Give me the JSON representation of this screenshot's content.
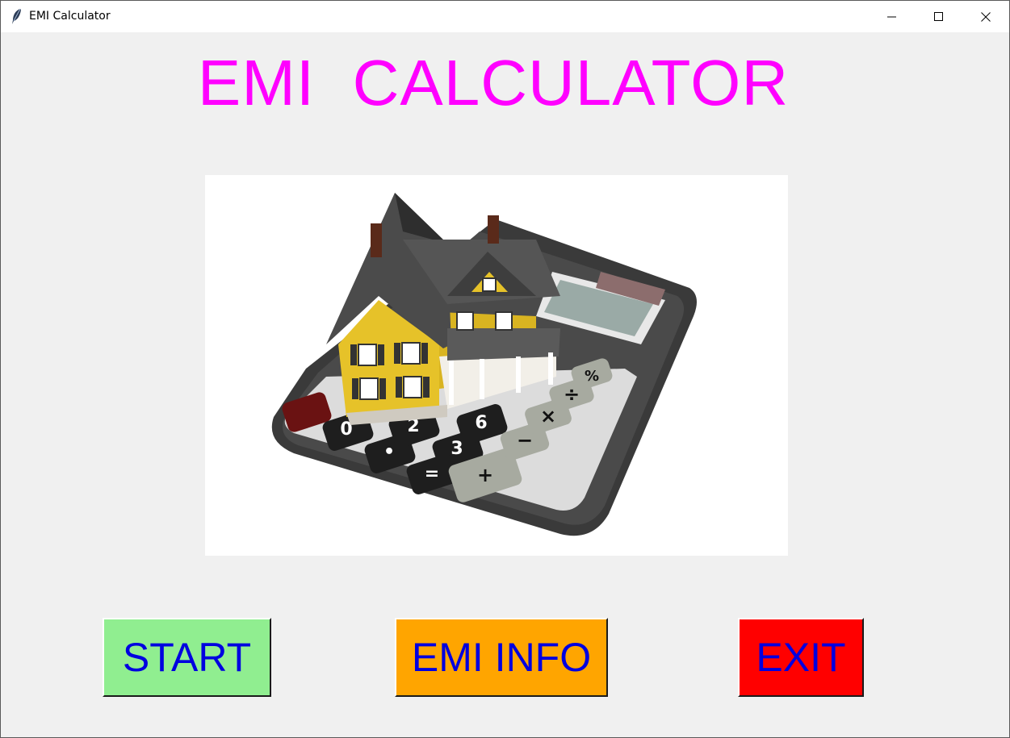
{
  "window": {
    "title": "EMI Calculator",
    "app_icon": "feather-icon",
    "controls": [
      "minimize-icon",
      "maximize-icon",
      "close-icon"
    ]
  },
  "main": {
    "heading": "EMI  CALCULATOR",
    "heading_color": "#ff00ff",
    "hero_image": "house-on-calculator-image",
    "calculator_keys": [
      "0",
      "•",
      "2",
      "3",
      "6",
      "=",
      "+",
      "−",
      "×",
      "÷",
      "%"
    ]
  },
  "buttons": {
    "start": {
      "label": "START",
      "color": "#90ee90"
    },
    "emi_info": {
      "label": "EMI INFO",
      "color": "#ffa500"
    },
    "exit": {
      "label": "EXIT",
      "color": "#ff0000"
    },
    "text_color": "#0000e0"
  }
}
